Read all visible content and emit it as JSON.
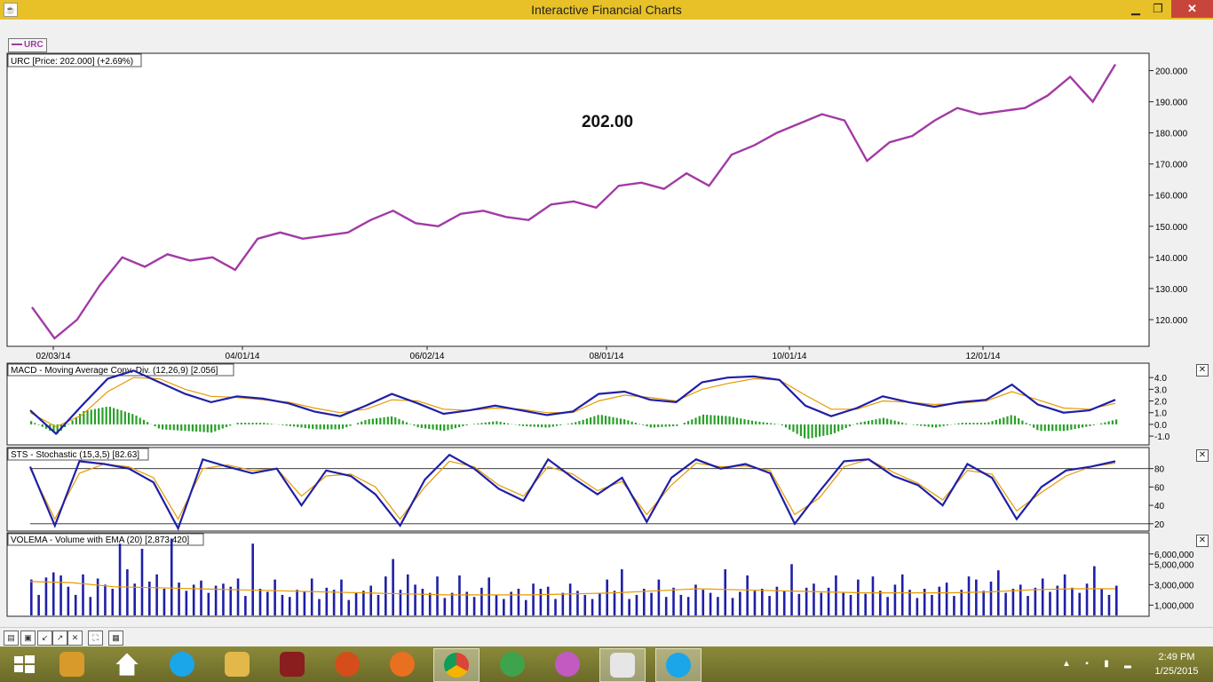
{
  "window": {
    "title": "Interactive Financial Charts",
    "minimize": "▁",
    "maximize": "❐",
    "close": "✕"
  },
  "legend": {
    "label": "URC"
  },
  "price_panel": {
    "header": "URC [Price: 202.000] (+2.69%)",
    "big_label": "202.00",
    "y_ticks": [
      "200.000",
      "190.000",
      "180.000",
      "170.000",
      "160.000",
      "150.000",
      "140.000",
      "130.000",
      "120.000"
    ],
    "x_ticks": [
      "02/03/14",
      "04/01/14",
      "06/02/14",
      "08/01/14",
      "10/01/14",
      "12/01/14"
    ]
  },
  "macd_panel": {
    "header": "MACD - Moving Average Conv. Div. (12,26,9) [2.056]",
    "y_ticks": [
      "4.0",
      "3.0",
      "2.0",
      "1.0",
      "0.0",
      "-1.0"
    ],
    "close": "✕"
  },
  "sto_panel": {
    "header": "STS - Stochastic (15,3,5) [82.63]",
    "y_ticks": [
      "80",
      "60",
      "40",
      "20"
    ],
    "close": "✕"
  },
  "vol_panel": {
    "header": "VOLEMA - Volume with EMA (20) [2,873,420]",
    "y_ticks": [
      "6,000,000",
      "5,000,000",
      "3,000,000",
      "1,000,000"
    ],
    "close": "✕"
  },
  "chart_data": [
    {
      "type": "line",
      "title": "URC [Price: 202.000] (+2.69%)",
      "series": [
        {
          "name": "URC",
          "x_days": [
            0,
            7,
            14,
            21,
            28,
            35,
            42,
            49,
            56,
            63,
            70,
            77,
            84,
            91,
            98,
            105,
            112,
            119,
            126,
            133,
            140,
            147,
            154,
            161,
            168,
            175,
            182,
            189,
            196,
            203,
            210,
            217,
            224,
            231,
            238,
            245,
            252,
            259,
            266,
            273,
            280,
            287,
            294,
            301,
            308,
            315,
            322,
            329,
            336
          ],
          "values": [
            124,
            114,
            120,
            131,
            140,
            137,
            141,
            139,
            140,
            136,
            146,
            148,
            146,
            147,
            148,
            152,
            155,
            151,
            150,
            154,
            155,
            153,
            152,
            157,
            158,
            156,
            163,
            164,
            162,
            167,
            163,
            173,
            176,
            180,
            183,
            186,
            184,
            171,
            177,
            179,
            184,
            188,
            186,
            187,
            188,
            192,
            198,
            190,
            202
          ]
        }
      ],
      "x_ticks": [
        "02/03/14",
        "04/01/14",
        "06/02/14",
        "08/01/14",
        "10/01/14",
        "12/01/14"
      ],
      "ylim": [
        112,
        205
      ]
    },
    {
      "type": "line",
      "title": "MACD - Moving Average Conv. Div. (12,26,9) [2.056]",
      "series": [
        {
          "values": [
            1.2,
            -0.8,
            1.6,
            3.9,
            4.6,
            3.6,
            2.6,
            1.9,
            2.4,
            2.2,
            1.8,
            1.1,
            0.7,
            1.6,
            2.6,
            1.8,
            0.9,
            1.2,
            1.6,
            1.2,
            0.8,
            1.1,
            2.6,
            2.8,
            2.1,
            1.9,
            3.6,
            4.0,
            4.1,
            3.8,
            1.6,
            0.7,
            1.4,
            2.4,
            1.9,
            1.5,
            1.9,
            2.1,
            3.4,
            1.7,
            1.0,
            1.2,
            2.1
          ]
        },
        {
          "values": [
            1.0,
            -0.2,
            0.8,
            2.8,
            4.0,
            3.9,
            3.0,
            2.4,
            2.3,
            2.1,
            1.9,
            1.4,
            1.0,
            1.3,
            2.1,
            2.0,
            1.3,
            1.2,
            1.4,
            1.3,
            1.0,
            1.0,
            2.0,
            2.5,
            2.3,
            2.0,
            3.0,
            3.5,
            3.9,
            3.8,
            2.5,
            1.3,
            1.3,
            2.0,
            1.9,
            1.7,
            1.8,
            2.0,
            2.8,
            2.1,
            1.4,
            1.3,
            1.8
          ]
        }
      ],
      "ylim": [
        -1.6,
        5.0
      ]
    },
    {
      "type": "line",
      "title": "STS - Stochastic (15,3,5) [82.63]",
      "series": [
        {
          "values": [
            82,
            18,
            88,
            85,
            80,
            65,
            15,
            90,
            82,
            75,
            80,
            40,
            78,
            72,
            52,
            18,
            68,
            95,
            80,
            58,
            45,
            90,
            70,
            52,
            70,
            22,
            70,
            90,
            80,
            85,
            75,
            20,
            55,
            88,
            90,
            72,
            62,
            40,
            85,
            70,
            25,
            60,
            78,
            82,
            88
          ]
        },
        {
          "values": [
            80,
            25,
            75,
            85,
            82,
            70,
            25,
            80,
            84,
            78,
            80,
            50,
            72,
            74,
            60,
            25,
            60,
            88,
            82,
            62,
            50,
            82,
            74,
            56,
            66,
            30,
            62,
            86,
            82,
            83,
            78,
            30,
            48,
            82,
            90,
            76,
            64,
            46,
            78,
            74,
            34,
            54,
            72,
            82,
            86
          ]
        }
      ],
      "ylim": [
        14,
        100
      ]
    },
    {
      "type": "bar",
      "title": "VOLEMA - Volume with EMA (20) [2,873,420]",
      "values": [
        3.5,
        2.0,
        3.7,
        4.2,
        3.9,
        2.8,
        2.0,
        4.0,
        1.8,
        3.6,
        3.0,
        2.6,
        7.0,
        4.5,
        3.1,
        6.5,
        3.3,
        4.0,
        2.6,
        7.5,
        3.2,
        2.4,
        3.0,
        3.4,
        2.2,
        2.9,
        3.1,
        2.8,
        3.6,
        1.9,
        7.0,
        2.6,
        2.3,
        3.5,
        2.0,
        1.8,
        2.5,
        2.3,
        3.6,
        1.6,
        2.7,
        2.5,
        3.5,
        1.5,
        2.2,
        2.4,
        2.9,
        2.0,
        3.8,
        5.5,
        2.5,
        4.0,
        3.0,
        2.6,
        2.2,
        3.8,
        1.7,
        2.2,
        3.9,
        2.3,
        1.8,
        2.7,
        3.7,
        2.0,
        1.6,
        2.3,
        2.6,
        1.5,
        3.1,
        2.6,
        2.8,
        1.6,
        2.2,
        3.1,
        2.4,
        2.0,
        1.6,
        2.2,
        3.5,
        2.4,
        4.5,
        1.6,
        2.0,
        2.6,
        2.2,
        3.5,
        1.8,
        2.7,
        2.0,
        1.8,
        3.0,
        2.5,
        2.2,
        1.8,
        4.5,
        1.7,
        2.3,
        3.9,
        2.4,
        2.6,
        1.9,
        2.8,
        2.4,
        5.0,
        2.1,
        2.7,
        3.1,
        2.2,
        2.7,
        3.9,
        2.2,
        2.0,
        3.5,
        2.1,
        3.8,
        2.4,
        1.8,
        3.0,
        4.0,
        2.5,
        1.7,
        2.6,
        2.0,
        2.8,
        3.2,
        1.9,
        2.5,
        3.8,
        3.5,
        2.4,
        3.3,
        4.4,
        2.2,
        2.6,
        3.0,
        1.9,
        2.7,
        3.6,
        2.3,
        2.9,
        4.0,
        2.7,
        2.2,
        3.1,
        4.8,
        2.6,
        2.0,
        2.9
      ],
      "ema": [
        3.3,
        3.2,
        2.8,
        2.7,
        2.6,
        2.5,
        2.4,
        2.3,
        2.2,
        2.1,
        2.0,
        2.0,
        2.0,
        2.1,
        2.2,
        2.4,
        2.6,
        2.5,
        2.4,
        2.3,
        2.2,
        2.2,
        2.2,
        2.3,
        2.5,
        2.6,
        2.6
      ],
      "ylim": [
        0,
        7.8
      ]
    }
  ]
}
